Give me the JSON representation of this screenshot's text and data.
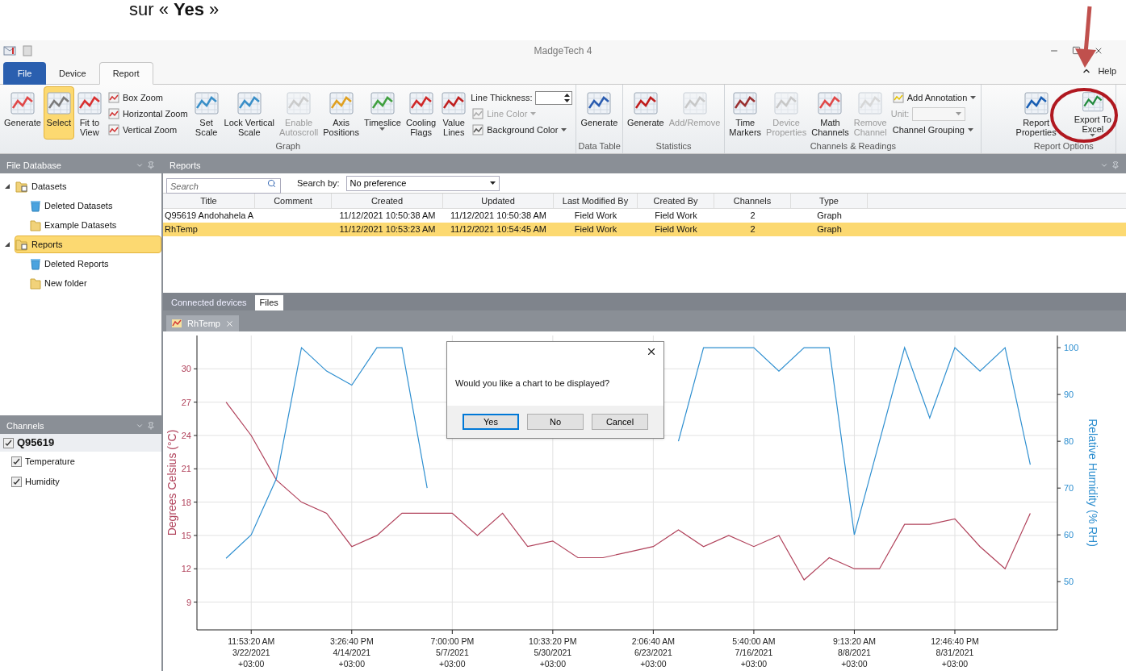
{
  "document": {
    "caption": "sur « **Yes** »"
  },
  "window": {
    "title": "MadgeTech 4"
  },
  "menu_tabs": [
    {
      "label": "File",
      "kind": "file",
      "selected": false
    },
    {
      "label": "Device",
      "kind": "tab",
      "selected": false
    },
    {
      "label": "Report",
      "kind": "tab",
      "selected": true
    }
  ],
  "help": "Help",
  "ribbon": {
    "groups": [
      {
        "label": "Graph",
        "items": [
          {
            "kind": "large",
            "label": "Generate",
            "disabled": false,
            "selected": false,
            "dropdown": false
          },
          {
            "kind": "large",
            "label": "Select",
            "disabled": false,
            "selected": true,
            "dropdown": false
          },
          {
            "kind": "large",
            "label": "Fit to\nView",
            "disabled": false,
            "selected": false,
            "dropdown": false
          },
          {
            "kind": "stack",
            "items": [
              {
                "kind": "button",
                "label": "Box Zoom",
                "disabled": false,
                "dropdown": false
              },
              {
                "kind": "button",
                "label": "Horizontal Zoom",
                "disabled": false,
                "dropdown": false
              },
              {
                "kind": "button",
                "label": "Vertical Zoom",
                "disabled": false,
                "dropdown": false
              }
            ]
          },
          {
            "kind": "large",
            "label": "Set\nScale",
            "disabled": false,
            "selected": false,
            "dropdown": false
          },
          {
            "kind": "large",
            "label": "Lock Vertical\nScale",
            "disabled": false,
            "selected": false,
            "dropdown": false
          },
          {
            "kind": "large",
            "label": "Enable\nAutoscroll",
            "disabled": true,
            "selected": false,
            "dropdown": false
          },
          {
            "kind": "large",
            "label": "Axis\nPositions",
            "disabled": false,
            "selected": false,
            "dropdown": false
          },
          {
            "kind": "large",
            "label": "Timeslice",
            "disabled": false,
            "selected": false,
            "dropdown": true
          },
          {
            "kind": "large",
            "label": "Cooling\nFlags",
            "disabled": false,
            "selected": false,
            "dropdown": false
          },
          {
            "kind": "large",
            "label": "Value\nLines",
            "disabled": false,
            "selected": false,
            "dropdown": false
          },
          {
            "kind": "stack",
            "items": [
              {
                "kind": "spin",
                "label": "Line Thickness:",
                "disabled": false
              },
              {
                "kind": "button",
                "label": "Line Color",
                "disabled": true,
                "dropdown": true
              },
              {
                "kind": "button",
                "label": "Background Color",
                "disabled": false,
                "dropdown": true
              }
            ]
          }
        ]
      },
      {
        "label": "Data Table",
        "items": [
          {
            "kind": "large",
            "label": "Generate",
            "disabled": false,
            "selected": false,
            "dropdown": false
          }
        ]
      },
      {
        "label": "Statistics",
        "items": [
          {
            "kind": "large",
            "label": "Generate",
            "disabled": false,
            "selected": false,
            "dropdown": false
          },
          {
            "kind": "large",
            "label": "Add/Remove",
            "disabled": true,
            "selected": false,
            "dropdown": false
          }
        ]
      },
      {
        "label": "Channels & Readings",
        "items": [
          {
            "kind": "large",
            "label": "Time\nMarkers",
            "disabled": false,
            "selected": false,
            "dropdown": false
          },
          {
            "kind": "large",
            "label": "Device\nProperties",
            "disabled": true,
            "selected": false,
            "dropdown": false
          },
          {
            "kind": "large",
            "label": "Math\nChannels",
            "disabled": false,
            "selected": false,
            "dropdown": false
          },
          {
            "kind": "large",
            "label": "Remove\nChannel",
            "disabled": true,
            "selected": false,
            "dropdown": false
          },
          {
            "kind": "stack",
            "items": [
              {
                "kind": "button",
                "label": "Add Annotation",
                "disabled": false,
                "dropdown": true
              },
              {
                "kind": "combo",
                "label": "Unit:",
                "disabled": true
              },
              {
                "kind": "button",
                "label": "Channel Grouping",
                "disabled": false,
                "dropdown": true
              }
            ]
          }
        ]
      },
      {
        "label": "Report Options",
        "items": [
          {
            "kind": "large",
            "label": "Report\nProperties",
            "disabled": false,
            "selected": false,
            "dropdown": false
          },
          {
            "kind": "large",
            "label": "Export To\nExcel",
            "disabled": false,
            "selected": false,
            "dropdown": true
          }
        ]
      }
    ]
  },
  "file_database": {
    "title": "File Database",
    "tree": [
      {
        "label": "Datasets",
        "kind": "root",
        "expanded": true,
        "selected": false,
        "children": [
          {
            "label": "Deleted Datasets",
            "kind": "deleted",
            "selected": false
          },
          {
            "label": "Example Datasets",
            "kind": "folder",
            "selected": false
          }
        ]
      },
      {
        "label": "Reports",
        "kind": "root",
        "expanded": true,
        "selected": true,
        "children": [
          {
            "label": "Deleted Reports",
            "kind": "deleted",
            "selected": false
          },
          {
            "label": "New folder",
            "kind": "folder",
            "selected": false
          }
        ]
      }
    ]
  },
  "channels": {
    "title": "Channels",
    "device": {
      "label": "Q95619",
      "checked": true
    },
    "items": [
      {
        "label": "Temperature",
        "checked": true
      },
      {
        "label": "Humidity",
        "checked": true
      }
    ]
  },
  "reports": {
    "title": "Reports",
    "search": {
      "placeholder": "Search"
    },
    "search_by_label": "Search by:",
    "search_by_value": "No preference",
    "table": {
      "columns": [
        "Title",
        "Comment",
        "Created",
        "Updated",
        "Last Modified By",
        "Created By",
        "Channels",
        "Type"
      ],
      "rows": [
        {
          "selected": false,
          "cells": [
            "Q95619 Andohahela A",
            "",
            "11/12/2021 10:50:38 AM",
            "11/12/2021 10:50:38 AM",
            "Field Work",
            "Field Work",
            "2",
            "Graph"
          ]
        },
        {
          "selected": true,
          "cells": [
            "RhTemp",
            "",
            "11/12/2021 10:53:23 AM",
            "11/12/2021 10:54:45 AM",
            "Field Work",
            "Field Work",
            "2",
            "Graph"
          ]
        }
      ]
    }
  },
  "bottom_tabs": [
    {
      "label": "Connected devices",
      "selected": false
    },
    {
      "label": "Files",
      "selected": true
    }
  ],
  "document_tab": {
    "label": "RhTemp"
  },
  "chart": {
    "chart_data": {
      "type": "line",
      "ylabel": "Degrees Celsius (°C)",
      "y2label": "Relative Humidity (% RH)",
      "categories": [
        null,
        "11:53:20 AM\n3/22/2021\n+03:00",
        null,
        null,
        null,
        "3:26:40 PM\n4/14/2021\n+03:00",
        null,
        null,
        null,
        "7:00:00 PM\n5/7/2021\n+03:00",
        null,
        null,
        null,
        "10:33:20 PM\n5/30/2021\n+03:00",
        null,
        null,
        null,
        "2:06:40 AM\n6/23/2021\n+03:00",
        null,
        null,
        null,
        "5:40:00 AM\n7/16/2021\n+03:00",
        null,
        null,
        null,
        "9:13:20 AM\n8/8/2021\n+03:00",
        null,
        null,
        null,
        "12:46:40 PM\n8/31/2021\n+03:00",
        null,
        null,
        null
      ],
      "series": [
        {
          "color": "#b0415a",
          "values": [
            27,
            24,
            20,
            18,
            17,
            14,
            15,
            17,
            17,
            17,
            15,
            17,
            14,
            14.5,
            13,
            13,
            13.5,
            14,
            15.5,
            14,
            15,
            14,
            15,
            11,
            13,
            12,
            12,
            16,
            16,
            16.5,
            14,
            12,
            17
          ]
        },
        {
          "color": "#2e8fd0",
          "axis": "y2",
          "values": [
            55,
            60,
            72,
            100,
            95,
            92,
            100,
            100,
            70,
            null,
            null,
            null,
            null,
            null,
            null,
            null,
            null,
            null,
            80,
            100,
            100,
            100,
            95,
            100,
            100,
            60,
            80,
            100,
            85,
            100,
            95,
            100,
            75
          ]
        }
      ],
      "grid": true,
      "ylim": [
        6.5,
        33
      ],
      "y2lim": [
        39.7,
        102.6
      ],
      "yticks": [
        9,
        12,
        15,
        18,
        21,
        24,
        27,
        30
      ],
      "y2ticks": [
        50,
        60,
        70,
        80,
        90,
        100
      ]
    }
  },
  "dialog": {
    "message": "Would you like a chart to be displayed?",
    "buttons": [
      {
        "label": "Yes",
        "selected": true
      },
      {
        "label": "No",
        "selected": false
      },
      {
        "label": "Cancel",
        "selected": false
      }
    ]
  }
}
